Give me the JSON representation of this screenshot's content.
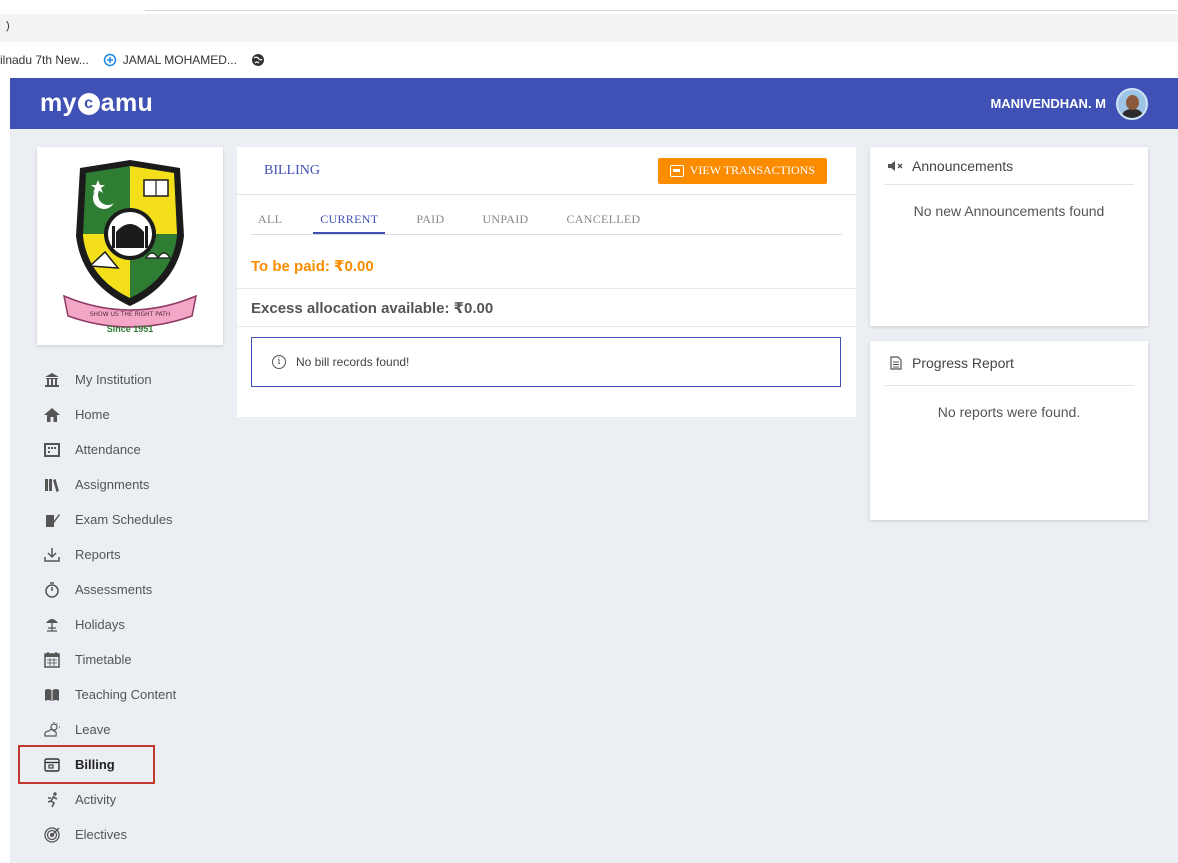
{
  "browser": {
    "bookmarks": [
      {
        "label": "ilnadu 7th New...",
        "icon": "none"
      },
      {
        "label": "JAMAL MOHAMED...",
        "icon": "cloud-icon"
      },
      {
        "label": "",
        "icon": "globe-icon"
      }
    ]
  },
  "header": {
    "logo_prefix": "my",
    "logo_c": "c",
    "logo_suffix": "amu",
    "user_name": "MANIVENDHAN. M",
    "brand_color": "#3f51b5"
  },
  "institution": {
    "since": "Since 1951",
    "motto": "SHOW US THE RIGHT PATH"
  },
  "sidebar": {
    "items": [
      {
        "label": "My Institution",
        "icon": "institution-icon"
      },
      {
        "label": "Home",
        "icon": "home-icon"
      },
      {
        "label": "Attendance",
        "icon": "attendance-icon"
      },
      {
        "label": "Assignments",
        "icon": "assignments-icon"
      },
      {
        "label": "Exam Schedules",
        "icon": "exam-icon"
      },
      {
        "label": "Reports",
        "icon": "download-icon"
      },
      {
        "label": "Assessments",
        "icon": "timer-icon"
      },
      {
        "label": "Holidays",
        "icon": "beach-icon"
      },
      {
        "label": "Timetable",
        "icon": "calendar-icon"
      },
      {
        "label": "Teaching Content",
        "icon": "book-icon"
      },
      {
        "label": "Leave",
        "icon": "weather-icon"
      },
      {
        "label": "Billing",
        "icon": "wallet-icon"
      },
      {
        "label": "Activity",
        "icon": "running-icon"
      },
      {
        "label": "Electives",
        "icon": "target-icon"
      }
    ],
    "active_index": 11
  },
  "billing": {
    "title": "BILLING",
    "view_transactions_label": "VIEW TRANSACTIONS",
    "tabs": [
      "ALL",
      "CURRENT",
      "PAID",
      "UNPAID",
      "CANCELLED"
    ],
    "active_tab": "CURRENT",
    "to_be_paid": "To be paid: ₹0.00",
    "excess": "Excess allocation available: ₹0.00",
    "empty_message": "No bill records found!",
    "accent_color": "#fb8c00"
  },
  "announcements": {
    "title": "Announcements",
    "empty": "No new Announcements found"
  },
  "progress": {
    "title": "Progress Report",
    "empty": "No reports were found."
  }
}
